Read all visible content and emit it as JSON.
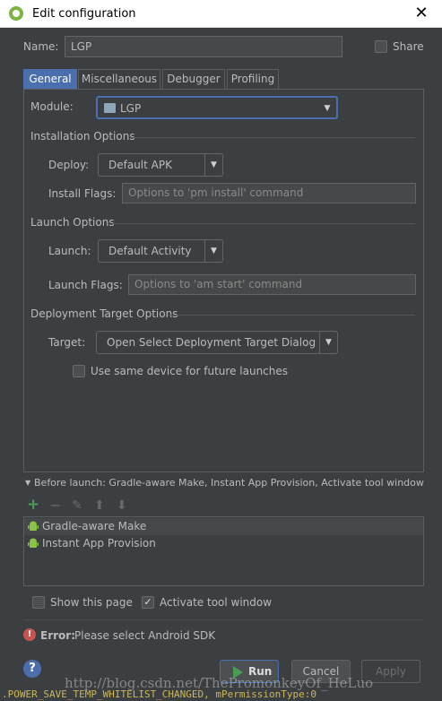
{
  "window": {
    "title": "Edit configuration",
    "close_glyph": "✕"
  },
  "name": {
    "label": "Name:",
    "value": "LGP"
  },
  "share": {
    "label": "Share",
    "checked": false
  },
  "tabs": [
    {
      "label": "General",
      "active": true
    },
    {
      "label": "Miscellaneous",
      "active": false
    },
    {
      "label": "Debugger",
      "active": false
    },
    {
      "label": "Profiling",
      "active": false
    }
  ],
  "module": {
    "label": "Module:",
    "value": "LGP"
  },
  "installation": {
    "title": "Installation Options",
    "deploy_label": "Deploy:",
    "deploy_value": "Default APK",
    "flags_label": "Install Flags:",
    "flags_placeholder": "Options to 'pm install' command"
  },
  "launch": {
    "title": "Launch Options",
    "launch_label": "Launch:",
    "launch_value": "Default Activity",
    "flags_label": "Launch Flags:",
    "flags_placeholder": "Options to 'am start' command"
  },
  "deployment": {
    "title": "Deployment Target Options",
    "target_label": "Target:",
    "target_value": "Open Select Deployment Target Dialog",
    "same_device_label": "Use same device for future launches"
  },
  "before_launch": {
    "title": "Before launch: Gradle-aware Make, Instant App Provision, Activate tool window",
    "items": [
      "Gradle-aware Make",
      "Instant App Provision"
    ]
  },
  "options": {
    "show_page_label": "Show this page",
    "show_page_checked": false,
    "activate_label": "Activate tool window",
    "activate_checked": true
  },
  "error": {
    "prefix": "Error:",
    "message": "Please select Android SDK"
  },
  "buttons": {
    "run": "Run",
    "cancel": "Cancel",
    "apply": "Apply",
    "help": "?"
  },
  "watermark": "http://blog.csdn.net/ThePromonkeyOf_HeLuo",
  "background_log": ".POWER_SAVE_TEMP_WHITELIST_CHANGED, mPermissionType:0",
  "colors": {
    "accent": "#4b6eaf",
    "error": "#c75450",
    "run_green": "#499c54",
    "android_green": "#8bc34a"
  }
}
